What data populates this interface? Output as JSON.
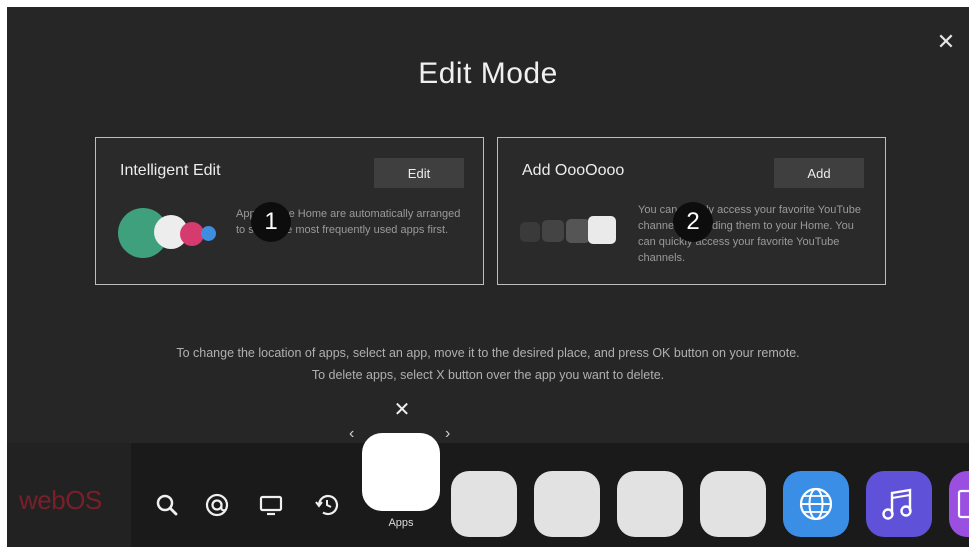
{
  "screen": {
    "title": "Edit Mode",
    "close_glyph": "✕"
  },
  "cards": [
    {
      "title": "Intelligent Edit",
      "button_label": "Edit",
      "description": "Apps on the Home are automatically arranged to show the most frequently used apps first.",
      "badge": "1"
    },
    {
      "title": "Add OooOooo",
      "button_label": "Add",
      "description": "You can quickly access your favorite YouTube channels by adding them to your Home. You can quickly access your favorite YouTube channels.",
      "badge": "2"
    }
  ],
  "instructions": {
    "line1": "To change the location of apps, select an app, move it to the desired place, and press OK button on your remote.",
    "line2": "To delete apps, select X button over the app you want to delete."
  },
  "dock": {
    "logo": "webOS",
    "selected_label": "Apps",
    "delete_glyph": "✕",
    "arrow_left": "‹",
    "arrow_right": "›",
    "icons": [
      "search-icon",
      "input-icon",
      "tv-icon",
      "history-icon",
      "globe-icon",
      "music-icon",
      "gallery-icon"
    ]
  },
  "colors": {
    "background": "#262626",
    "dock": "#1a1a1a",
    "globe_app": "#3a8ee6",
    "music_app": "#5f52d9",
    "gallery_app": "#9a4fe0",
    "green_dot": "#3fa07e",
    "pink_dot": "#d63b6f",
    "blue_dot": "#3d8de0"
  }
}
